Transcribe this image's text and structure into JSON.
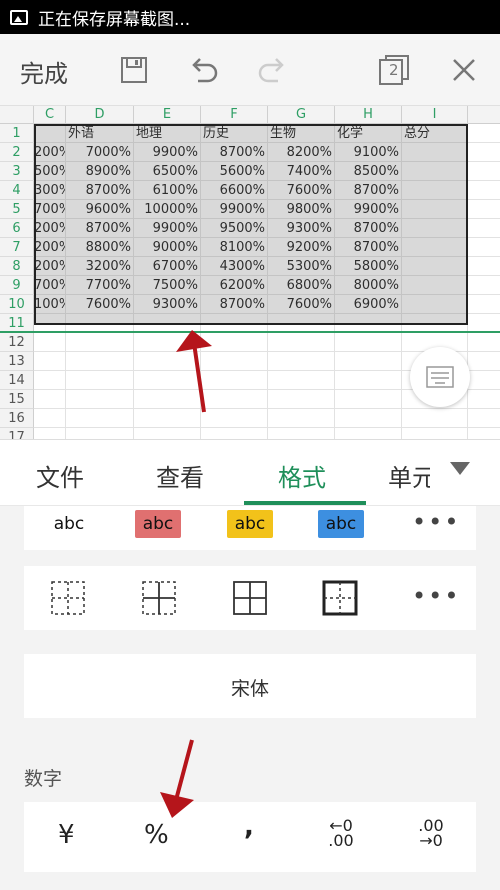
{
  "status_bar": {
    "text": "正在保存屏幕截图..."
  },
  "toolbar": {
    "done_label": "完成",
    "copies_count": "2"
  },
  "sheet": {
    "columns": [
      "C",
      "D",
      "E",
      "F",
      "G",
      "H",
      "I"
    ],
    "rows": [
      "1",
      "2",
      "3",
      "4",
      "5",
      "6",
      "7",
      "8",
      "9",
      "10",
      "11",
      "12",
      "13",
      "14",
      "15",
      "16",
      "17"
    ],
    "header_row": [
      "",
      "外语",
      "地理",
      "历史",
      "生物",
      "化学",
      "总分"
    ],
    "data": [
      [
        "200%",
        "7000%",
        "9900%",
        "8700%",
        "8200%",
        "9100%",
        ""
      ],
      [
        "500%",
        "8900%",
        "6500%",
        "5600%",
        "7400%",
        "8500%",
        ""
      ],
      [
        "300%",
        "8700%",
        "6100%",
        "6600%",
        "7600%",
        "8700%",
        ""
      ],
      [
        "700%",
        "9600%",
        "10000%",
        "9900%",
        "9800%",
        "9900%",
        ""
      ],
      [
        "200%",
        "8700%",
        "9900%",
        "9500%",
        "9300%",
        "8700%",
        ""
      ],
      [
        "200%",
        "8800%",
        "9000%",
        "8100%",
        "9200%",
        "8700%",
        ""
      ],
      [
        "200%",
        "3200%",
        "6700%",
        "4300%",
        "5300%",
        "5800%",
        ""
      ],
      [
        "700%",
        "7700%",
        "7500%",
        "6200%",
        "6800%",
        "8000%",
        ""
      ],
      [
        "100%",
        "7600%",
        "9300%",
        "8700%",
        "7600%",
        "6900%",
        ""
      ]
    ]
  },
  "tabs": {
    "file": "文件",
    "view": "查看",
    "format": "格式",
    "cell": "单元"
  },
  "format_panel": {
    "text_styles": [
      {
        "label": "abc",
        "bg": "#ffffff"
      },
      {
        "label": "abc",
        "bg": "#e07070"
      },
      {
        "label": "abc",
        "bg": "#f2c21a"
      },
      {
        "label": "abc",
        "bg": "#3d8fe0"
      }
    ],
    "more": "•••",
    "font_name": "宋体",
    "number_section_label": "数字",
    "number_formats": {
      "currency": "¥",
      "percent": "%",
      "comma": ","
    },
    "increase_decimal": {
      "top": "←0",
      "bottom": ".00"
    },
    "decrease_decimal": {
      "top": ".00",
      "bottom": "→0"
    }
  },
  "colors": {
    "accent_green": "#1f8f5a",
    "arrow_red": "#b5151b"
  }
}
